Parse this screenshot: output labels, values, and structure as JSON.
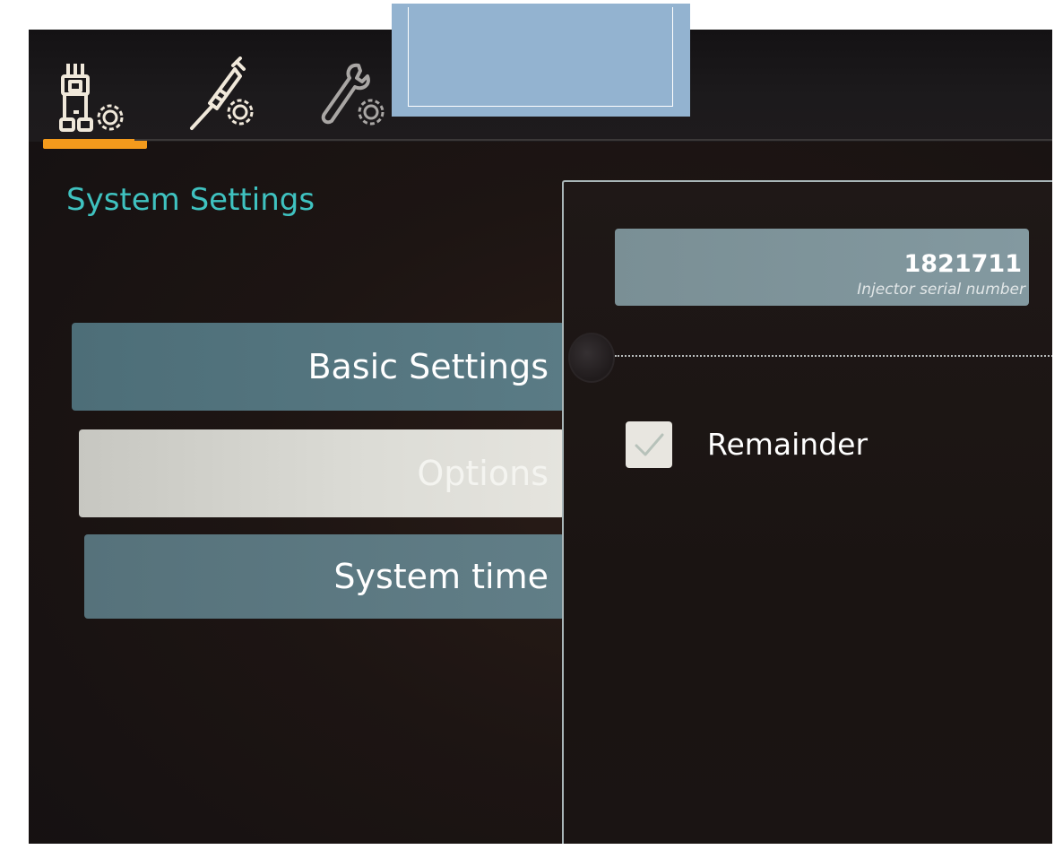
{
  "tabs": [
    {
      "icon": "system-settings-icon",
      "active": true
    },
    {
      "icon": "syringe-settings-icon",
      "active": false
    },
    {
      "icon": "wrench-settings-icon",
      "active": false
    }
  ],
  "colors": {
    "accent": "#f39a1c",
    "title": "#3fc2c0",
    "redaction": "#93b3d0"
  },
  "section_title": "System Settings",
  "menu": {
    "basic_settings": "Basic Settings",
    "options": "Options",
    "system_time": "System time"
  },
  "panel": {
    "serial_value": "1821711",
    "serial_label": "Injector serial number",
    "checkbox_label": "Remainder",
    "checkbox_checked": true
  }
}
